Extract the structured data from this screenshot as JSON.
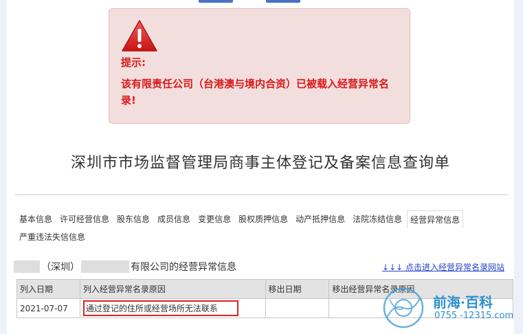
{
  "alert": {
    "title": "提示:",
    "message": "该有限责任公司（台港澳与境内合资）已被载入经营异常名录!"
  },
  "document_title": "深圳市市场监督管理局商事主体登记及备案信息查询单",
  "tabs": [
    {
      "label": "基本信息"
    },
    {
      "label": "许可经营信息"
    },
    {
      "label": "股东信息"
    },
    {
      "label": "成员信息"
    },
    {
      "label": "变更信息"
    },
    {
      "label": "股权质押信息"
    },
    {
      "label": "动产抵押信息"
    },
    {
      "label": "法院冻结信息"
    },
    {
      "label": "经营异常信息"
    },
    {
      "label": "严重违法失信信息"
    }
  ],
  "active_tab": "经营异常信息",
  "company_line": {
    "part1": "（深圳）",
    "part2": "有限公司的经营异常信息"
  },
  "directory_link": "↓↓↓ 点击进入经营异常名录网站",
  "table": {
    "headers": [
      "列入日期",
      "列入经营异常名录原因",
      "移出日期",
      "移出经营异常名录原因"
    ],
    "rows": [
      [
        "2021-07-07",
        "通过登记的住所或经营场所无法联系",
        "",
        ""
      ]
    ]
  },
  "watermark": {
    "name": "前海·百科",
    "phone": "0755 -12315.com"
  },
  "colors": {
    "alert_bg": "#f3dede",
    "alert_text": "#d91a1a",
    "link": "#2442c7",
    "highlight_border": "#e02020"
  }
}
